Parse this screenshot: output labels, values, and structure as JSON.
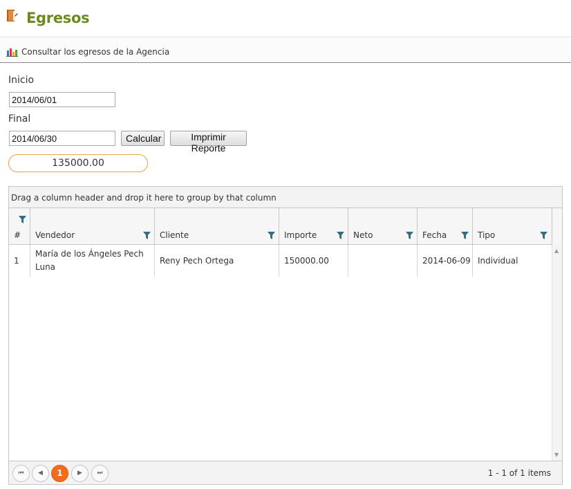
{
  "header": {
    "title": "Egresos",
    "icon": "book-icon"
  },
  "subbar": {
    "label": "Consultar los egresos de la Agencia",
    "icon": "bar-chart-icon"
  },
  "form": {
    "inicio_label": "Inicio",
    "inicio_value": "2014/06/01",
    "final_label": "Final",
    "final_value": "2014/06/30",
    "calcular_label": "Calcular",
    "imprimir_label": "Imprimir Reporte",
    "total_value": "135000.00"
  },
  "grid": {
    "group_hint": "Drag a column header and drop it here to group by that column",
    "columns": [
      "#",
      "Vendedor",
      "Cliente",
      "Importe",
      "Neto",
      "Fecha",
      "Tipo"
    ],
    "rows": [
      {
        "num": "1",
        "vendedor_line1": "María de los Ángeles Pech",
        "vendedor_line2": "Luna",
        "cliente": "Reny Pech Ortega",
        "importe": "150000.00",
        "neto": "",
        "fecha": "2014-06-09",
        "tipo": "Individual"
      }
    ],
    "pager": {
      "current_page": "1",
      "info": "1 - 1 of 1 items"
    }
  },
  "colors": {
    "title": "#6a8a1f",
    "accent": "#f06c1e",
    "total_border": "#e2a54c",
    "filter_icon": "#2e6f86"
  }
}
